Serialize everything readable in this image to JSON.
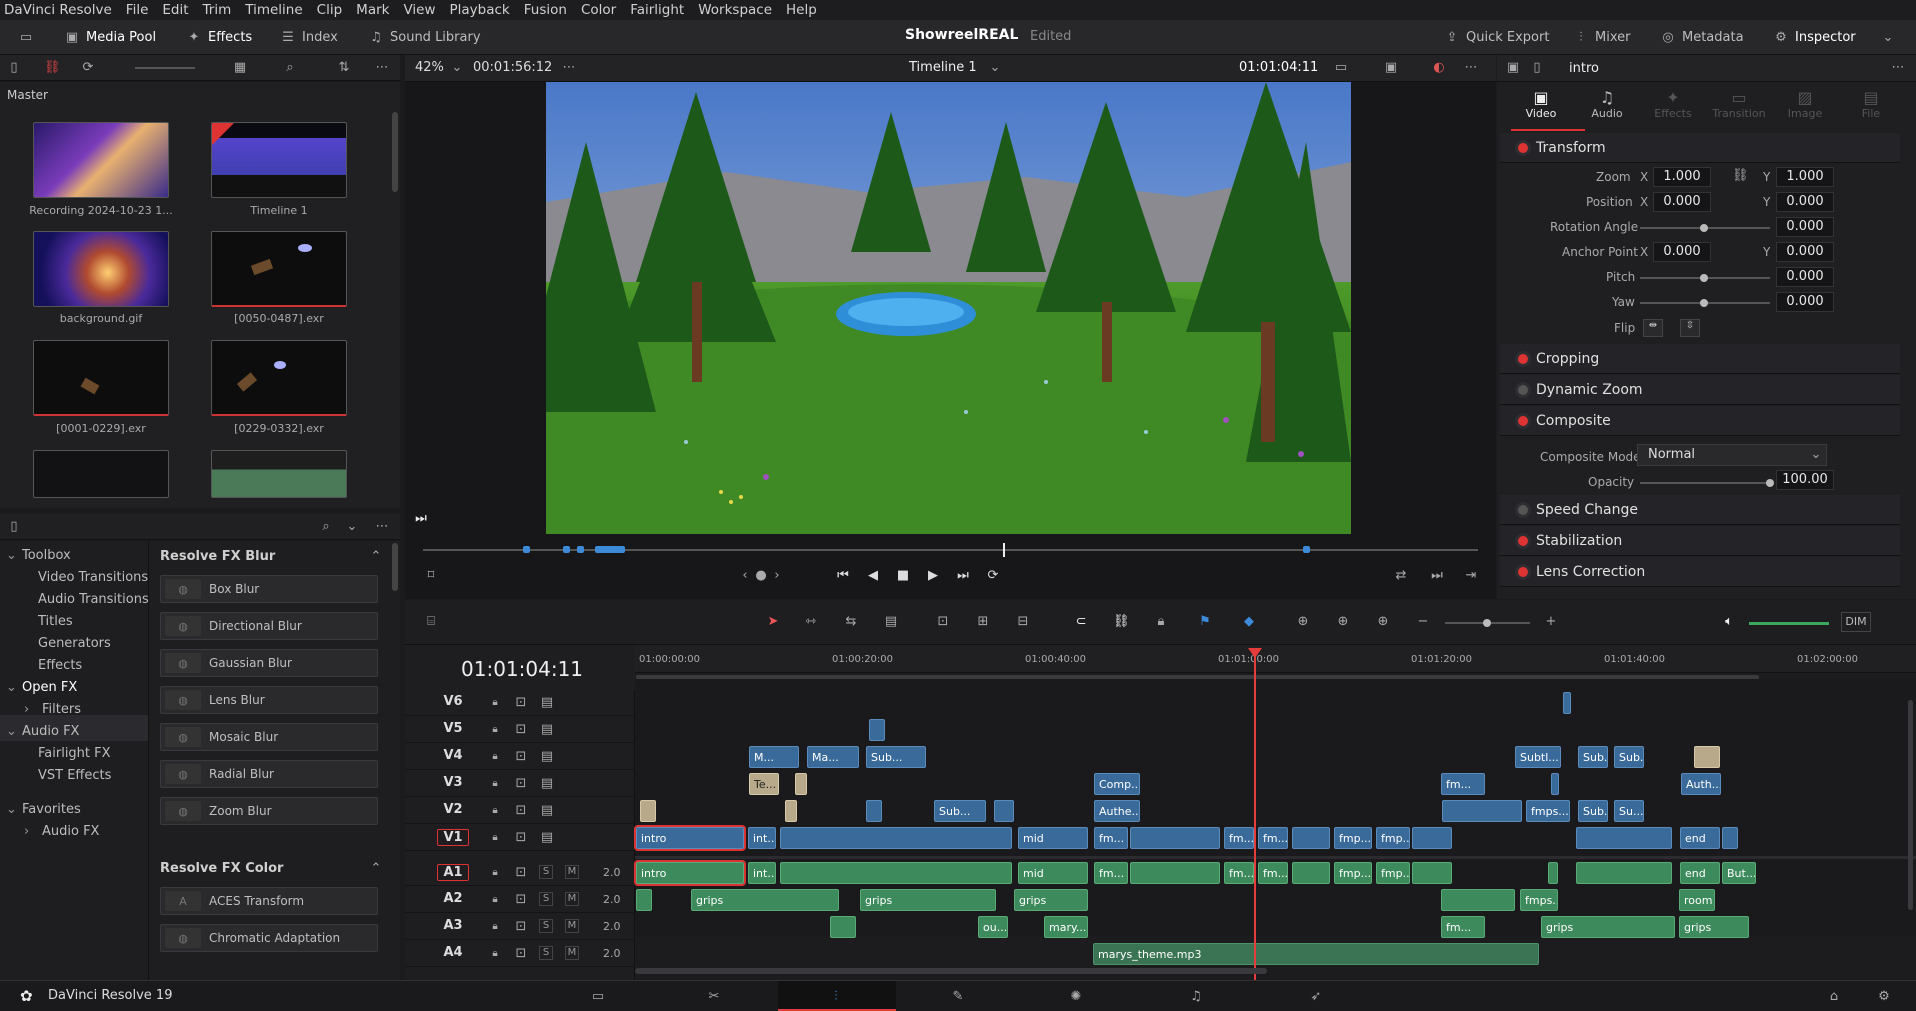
{
  "menu": [
    "DaVinci Resolve",
    "File",
    "Edit",
    "Trim",
    "Timeline",
    "Clip",
    "Mark",
    "View",
    "Playback",
    "Fusion",
    "Color",
    "Fairlight",
    "Workspace",
    "Help"
  ],
  "toolbar": {
    "media_pool": "Media Pool",
    "effects": "Effects",
    "index": "Index",
    "sound_library": "Sound Library",
    "project_title": "ShowreelREAL",
    "project_status": "Edited",
    "quick_export": "Quick Export",
    "mixer": "Mixer",
    "metadata": "Metadata",
    "inspector": "Inspector"
  },
  "viewer": {
    "zoom": "42%",
    "source_tc": "00:01:56:12",
    "timeline_name": "Timeline 1",
    "record_tc": "01:01:04:11"
  },
  "media_pool": {
    "bin": "Master",
    "items": [
      {
        "label": "Recording 2024-10-23 1..."
      },
      {
        "label": "Timeline 1"
      },
      {
        "label": "background.gif"
      },
      {
        "label": "[0050-0487].exr"
      },
      {
        "label": "[0001-0229].exr"
      },
      {
        "label": "[0229-0332].exr"
      }
    ]
  },
  "effects_library": {
    "tree": [
      {
        "label": "Toolbox",
        "level": 0,
        "open": true
      },
      {
        "label": "Video Transitions",
        "level": 1
      },
      {
        "label": "Audio Transitions",
        "level": 1
      },
      {
        "label": "Titles",
        "level": 1
      },
      {
        "label": "Generators",
        "level": 1
      },
      {
        "label": "Effects",
        "level": 1
      },
      {
        "label": "Open FX",
        "level": 0,
        "open": true,
        "selected": true
      },
      {
        "label": "Filters",
        "level": 1,
        "arrow": true
      },
      {
        "label": "Audio FX",
        "level": 0,
        "open": true
      },
      {
        "label": "Fairlight FX",
        "level": 1
      },
      {
        "label": "VST Effects",
        "level": 1
      },
      {
        "label": "Favorites",
        "level": 0,
        "open": true
      },
      {
        "label": "Audio FX",
        "level": 1,
        "arrow": true
      }
    ],
    "group1": "Resolve FX Blur",
    "blur": [
      "Box Blur",
      "Directional Blur",
      "Gaussian Blur",
      "Lens Blur",
      "Mosaic Blur",
      "Radial Blur",
      "Zoom Blur"
    ],
    "group2": "Resolve FX Color",
    "color": [
      "ACES Transform",
      "Chromatic Adaptation"
    ]
  },
  "inspector": {
    "clip_name": "intro",
    "tabs": [
      "Video",
      "Audio",
      "Effects",
      "Transition",
      "Image",
      "File"
    ],
    "transform": {
      "title": "Transform",
      "zoom_x": "1.000",
      "zoom_y": "1.000",
      "pos_x": "0.000",
      "pos_y": "0.000",
      "rotation": "0.000",
      "anchor_x": "0.000",
      "anchor_y": "0.000",
      "pitch": "0.000",
      "yaw": "0.000"
    },
    "labels": {
      "zoom": "Zoom",
      "position": "Position",
      "rotation": "Rotation Angle",
      "anchor": "Anchor Point",
      "pitch": "Pitch",
      "yaw": "Yaw",
      "flip": "Flip",
      "x": "X",
      "y": "Y"
    },
    "sections": [
      "Cropping",
      "Dynamic Zoom",
      "Composite",
      "Speed Change",
      "Stabilization",
      "Lens Correction"
    ],
    "composite": {
      "mode_label": "Composite Mode",
      "mode": "Normal",
      "opacity_label": "Opacity",
      "opacity": "100.00"
    }
  },
  "timeline": {
    "timecode": "01:01:04:11",
    "ruler": [
      "01:00:00:00",
      "01:00:20:00",
      "01:00:40:00",
      "01:01:00:00",
      "01:01:20:00",
      "01:01:40:00",
      "01:02:00:00"
    ],
    "video_tracks": [
      "V6",
      "V5",
      "V4",
      "V3",
      "V2",
      "V1"
    ],
    "audio_tracks": [
      "A1",
      "A2",
      "A3",
      "A4"
    ],
    "audio_level": "2.0",
    "clips": {
      "intro": "intro",
      "int": "int...",
      "mid": "mid",
      "fm": "fm...",
      "fmp": "fmp...",
      "end": "end",
      "but": "But...",
      "grips": "grips",
      "ou": "ou...",
      "mary": "mary...",
      "marys_theme": "marys_theme.mp3",
      "room": "room ...",
      "m": "M...",
      "ma": "Ma...",
      "sub": "Sub...",
      "subtl": "Subtl...",
      "te": "Te...",
      "comp": "Comp...",
      "authe": "Authe...",
      "auth": "Auth...",
      "fmps": "fmps...",
      "su": "Su..."
    },
    "dim": "DIM"
  },
  "app_name": "DaVinci Resolve 19"
}
